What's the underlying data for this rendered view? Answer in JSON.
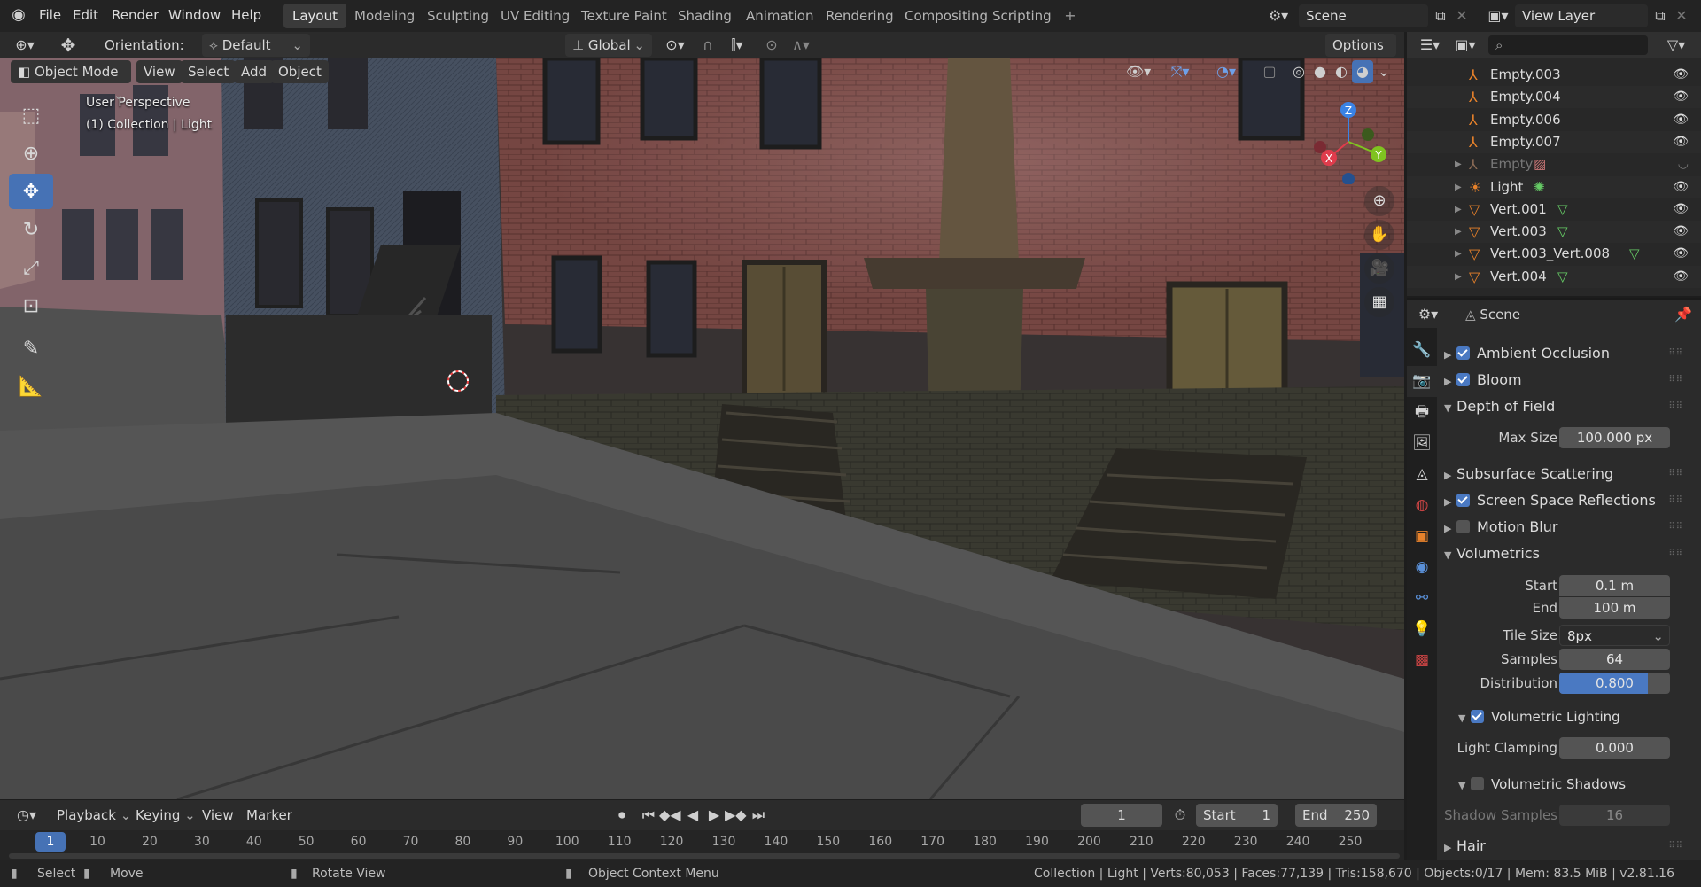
{
  "menu": [
    "File",
    "Edit",
    "Render",
    "Window",
    "Help"
  ],
  "workspaces": [
    "Layout",
    "Modeling",
    "Sculpting",
    "UV Editing",
    "Texture Paint",
    "Shading",
    "Animation",
    "Rendering",
    "Compositing",
    "Scripting"
  ],
  "active_workspace": "Layout",
  "scene_name": "Scene",
  "view_layer": "View Layer",
  "tool_header": {
    "orientation_label": "Orientation:",
    "orientation_value": "Default",
    "transform_space": "Global",
    "options": "Options"
  },
  "viewport_header": {
    "mode": "Object Mode",
    "menus": [
      "View",
      "Select",
      "Add",
      "Object"
    ]
  },
  "viewport": {
    "perspective": "User Perspective",
    "collection_info": "(1) Collection | Light"
  },
  "gizmo": {
    "x": "X",
    "y": "Y",
    "z": "Z"
  },
  "timeline": {
    "menus": [
      "Playback",
      "Keying",
      "View",
      "Marker"
    ],
    "current_frame": "1",
    "start_label": "Start",
    "start": "1",
    "end_label": "End",
    "end": "250",
    "ticks": [
      "1",
      "10",
      "20",
      "30",
      "40",
      "50",
      "60",
      "70",
      "80",
      "90",
      "100",
      "110",
      "120",
      "130",
      "140",
      "150",
      "160",
      "170",
      "180",
      "190",
      "200",
      "210",
      "220",
      "230",
      "240",
      "250"
    ]
  },
  "status": {
    "select": "Select",
    "move": "Move",
    "rotate": "Rotate View",
    "context": "Object Context Menu",
    "info": "Collection | Light | Verts:80,053 | Faces:77,139 | Tris:158,670 | Objects:0/17 | Mem: 83.5 MiB | v2.81.16"
  },
  "outliner": {
    "search_placeholder": "",
    "items": [
      {
        "name": "Empty.003",
        "type": "empty"
      },
      {
        "name": "Empty.004",
        "type": "empty"
      },
      {
        "name": "Empty.006",
        "type": "empty"
      },
      {
        "name": "Empty.007",
        "type": "empty"
      },
      {
        "name": "Empty",
        "type": "empty-image",
        "dim": true
      },
      {
        "name": "Light",
        "type": "light"
      },
      {
        "name": "Vert.001",
        "type": "mesh"
      },
      {
        "name": "Vert.003",
        "type": "mesh"
      },
      {
        "name": "Vert.003_Vert.008",
        "type": "mesh"
      },
      {
        "name": "Vert.004",
        "type": "mesh"
      }
    ]
  },
  "properties": {
    "context": "Scene",
    "sections": {
      "ao": "Ambient Occlusion",
      "bloom": "Bloom",
      "dof": "Depth of Field",
      "sss": "Subsurface Scattering",
      "ssr": "Screen Space Reflections",
      "mblur": "Motion Blur",
      "vol": "Volumetrics",
      "vol_light": "Volumetric Lighting",
      "vol_shadows": "Volumetric Shadows",
      "hair": "Hair"
    },
    "max_size_label": "Max Size",
    "max_size": "100.000 px",
    "start_label": "Start",
    "start": "0.1 m",
    "end_label": "End",
    "end": "100 m",
    "tile_size_label": "Tile Size",
    "tile_size": "8px",
    "samples_label": "Samples",
    "samples": "64",
    "distribution_label": "Distribution",
    "distribution": "0.800",
    "distribution_fraction": 0.8,
    "light_clamping_label": "Light Clamping",
    "light_clamping": "0.000",
    "shadow_samples_label": "Shadow Samples",
    "shadow_samples": "16"
  },
  "colors": {
    "accent": "#4672b5",
    "header": "#2b2b2b",
    "panel": "#2b2b2b",
    "x_axis": "#e03c4c",
    "y_axis": "#7fc320",
    "z_axis": "#3a83e6"
  }
}
